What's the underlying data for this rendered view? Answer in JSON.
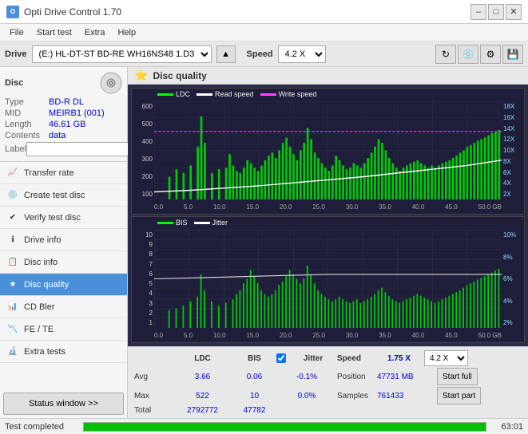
{
  "titlebar": {
    "title": "Opti Drive Control 1.70",
    "min_label": "–",
    "max_label": "□",
    "close_label": "✕"
  },
  "menubar": {
    "items": [
      "File",
      "Start test",
      "Extra",
      "Help"
    ]
  },
  "drivebar": {
    "label": "Drive",
    "drive_value": "(E:) HL-DT-ST BD-RE  WH16NS48 1.D3",
    "speed_label": "Speed",
    "speed_value": "4.2 X"
  },
  "disc_panel": {
    "title": "Disc",
    "type_label": "Type",
    "type_value": "BD-R DL",
    "mid_label": "MID",
    "mid_value": "MEIRB1 (001)",
    "length_label": "Length",
    "length_value": "46.61 GB",
    "contents_label": "Contents",
    "contents_value": "data",
    "label_label": "Label"
  },
  "nav": {
    "items": [
      {
        "label": "Transfer rate",
        "icon": "📈"
      },
      {
        "label": "Create test disc",
        "icon": "💿"
      },
      {
        "label": "Verify test disc",
        "icon": "✔"
      },
      {
        "label": "Drive info",
        "icon": "ℹ"
      },
      {
        "label": "Disc info",
        "icon": "📋"
      },
      {
        "label": "Disc quality",
        "icon": "★",
        "active": true
      },
      {
        "label": "CD Bler",
        "icon": "📊"
      },
      {
        "label": "FE / TE",
        "icon": "📉"
      },
      {
        "label": "Extra tests",
        "icon": "🔬"
      }
    ]
  },
  "status_btn": "Status window >>",
  "content": {
    "title": "Disc quality",
    "chart1": {
      "legend": [
        "LDC",
        "Read speed",
        "Write speed"
      ],
      "legend_colors": [
        "#00ff00",
        "white",
        "#ff00ff"
      ],
      "y_left_labels": [
        "600",
        "500",
        "400",
        "300",
        "200",
        "100"
      ],
      "y_right_labels": [
        "18X",
        "16X",
        "14X",
        "12X",
        "10X",
        "8X",
        "6X",
        "4X",
        "2X"
      ],
      "x_labels": [
        "0.0",
        "5.0",
        "10.0",
        "15.0",
        "20.0",
        "25.0",
        "30.0",
        "35.0",
        "40.0",
        "45.0",
        "50.0 GB"
      ]
    },
    "chart2": {
      "legend": [
        "BIS",
        "Jitter"
      ],
      "legend_colors": [
        "#00ff00",
        "white"
      ],
      "y_left_labels": [
        "10",
        "9",
        "8",
        "7",
        "6",
        "5",
        "4",
        "3",
        "2",
        "1"
      ],
      "y_right_labels": [
        "10%",
        "8%",
        "6%",
        "4%",
        "2%"
      ],
      "x_labels": [
        "0.0",
        "5.0",
        "10.0",
        "15.0",
        "20.0",
        "25.0",
        "30.0",
        "35.0",
        "40.0",
        "45.0",
        "50.0 GB"
      ]
    }
  },
  "stats": {
    "headers": [
      "",
      "LDC",
      "BIS",
      "",
      "Jitter",
      "Speed",
      "",
      ""
    ],
    "avg_label": "Avg",
    "avg_ldc": "3.66",
    "avg_bis": "0.06",
    "avg_jitter": "-0.1%",
    "max_label": "Max",
    "max_ldc": "522",
    "max_bis": "10",
    "max_jitter": "0.0%",
    "total_label": "Total",
    "total_ldc": "2792772",
    "total_bis": "47782",
    "jitter_checked": true,
    "jitter_label": "Jitter",
    "speed_label": "Speed",
    "speed_value": "1.75 X",
    "position_label": "Position",
    "position_value": "47731 MB",
    "samples_label": "Samples",
    "samples_value": "761433",
    "speed_select": "4.2 X",
    "start_full": "Start full",
    "start_part": "Start part"
  },
  "bottombar": {
    "label": "Test completed",
    "progress": 100,
    "time": "63:01"
  }
}
